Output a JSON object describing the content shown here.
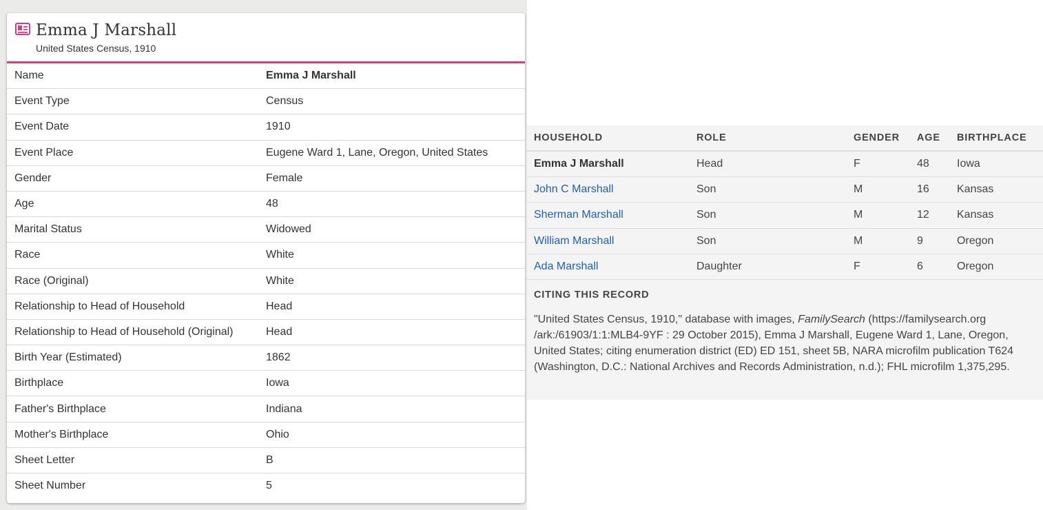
{
  "record": {
    "title": "Emma J Marshall",
    "subtitle": "United States Census, 1910",
    "icon": "record-card-icon",
    "accent_color": "#d63b80"
  },
  "fields": [
    {
      "label": "Name",
      "value": "Emma J Marshall",
      "bold": true
    },
    {
      "label": "Event Type",
      "value": "Census"
    },
    {
      "label": "Event Date",
      "value": "1910"
    },
    {
      "label": "Event Place",
      "value": "Eugene Ward 1, Lane, Oregon, United States"
    },
    {
      "label": "Gender",
      "value": "Female"
    },
    {
      "label": "Age",
      "value": "48"
    },
    {
      "label": "Marital Status",
      "value": "Widowed"
    },
    {
      "label": "Race",
      "value": "White"
    },
    {
      "label": "Race (Original)",
      "value": "White"
    },
    {
      "label": "Relationship to Head of Household",
      "value": "Head"
    },
    {
      "label": "Relationship to Head of Household (Original)",
      "value": "Head"
    },
    {
      "label": "Birth Year (Estimated)",
      "value": "1862"
    },
    {
      "label": "Birthplace",
      "value": "Iowa"
    },
    {
      "label": "Father's Birthplace",
      "value": "Indiana"
    },
    {
      "label": "Mother's Birthplace",
      "value": "Ohio"
    },
    {
      "label": "Sheet Letter",
      "value": "B"
    },
    {
      "label": "Sheet Number",
      "value": "5"
    }
  ],
  "household": {
    "headers": {
      "household": "HOUSEHOLD",
      "role": "ROLE",
      "gender": "GENDER",
      "age": "AGE",
      "birthplace": "BIRTHPLACE"
    },
    "members": [
      {
        "name": "Emma J Marshall",
        "role": "Head",
        "gender": "F",
        "age": "48",
        "birthplace": "Iowa",
        "link": false
      },
      {
        "name": "John C Marshall",
        "role": "Son",
        "gender": "M",
        "age": "16",
        "birthplace": "Kansas",
        "link": true
      },
      {
        "name": "Sherman Marshall",
        "role": "Son",
        "gender": "M",
        "age": "12",
        "birthplace": "Kansas",
        "link": true
      },
      {
        "name": "William Marshall",
        "role": "Son",
        "gender": "M",
        "age": "9",
        "birthplace": "Oregon",
        "link": true
      },
      {
        "name": "Ada Marshall",
        "role": "Daughter",
        "gender": "F",
        "age": "6",
        "birthplace": "Oregon",
        "link": true
      }
    ],
    "link_color": "#1f5fb4"
  },
  "citing": {
    "title": "CITING THIS RECORD",
    "text_before": "\"United States Census, 1910,\" database with images, ",
    "text_em": "FamilySearch",
    "text_after": " (https://familysearch.org /ark:/61903/1:1:MLB4-9YF : 29 October 2015), Emma J Marshall, Eugene Ward 1, Lane, Oregon, United States; citing enumeration district (ED) ED 151, sheet 5B, NARA microfilm publication T624 (Washington, D.C.: National Archives and Records Administration, n.d.); FHL microfilm 1,375,295."
  }
}
